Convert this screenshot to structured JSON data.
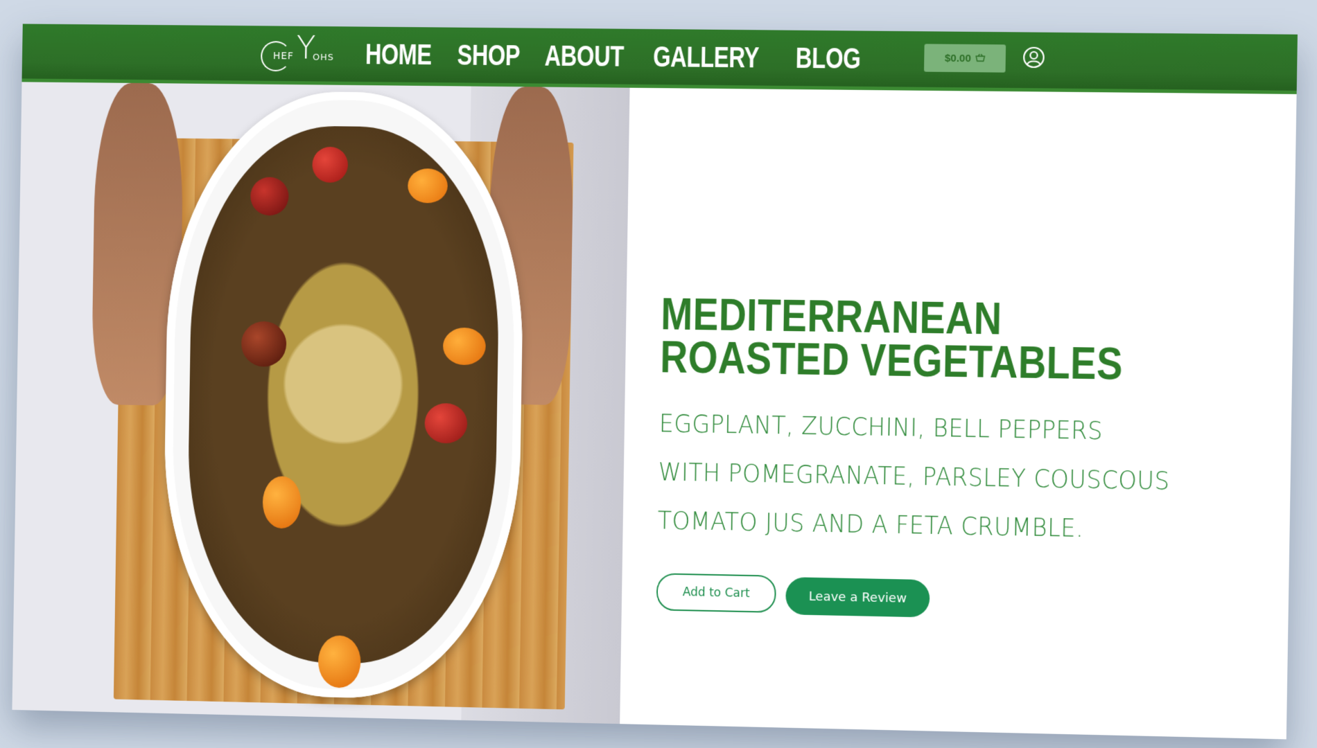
{
  "brand": {
    "logo_text_left": "HEF",
    "logo_letter": "Y",
    "logo_text_right": "OHS",
    "logo_alt": "CHEF YOHS"
  },
  "nav": {
    "items": [
      {
        "label": "HOME"
      },
      {
        "label": "SHOP"
      },
      {
        "label": "ABOUT"
      },
      {
        "label": "GALLERY"
      },
      {
        "label": "BLOG"
      }
    ]
  },
  "cart": {
    "total": "$0.00",
    "icon": "basket-icon"
  },
  "account": {
    "icon": "user-circle-icon"
  },
  "product": {
    "title": "MEDITERRANEAN ROASTED VEGETABLES",
    "description_lines": [
      "EGGPLANT, ZUCCHINI, BELL PEPPERS",
      "WITH POMEGRANATE, PARSLEY COUSCOUS",
      "TOMATO JUS AND A FETA CRUMBLE."
    ],
    "add_to_cart_label": "Add to Cart",
    "review_label": "Leave a Review"
  },
  "colors": {
    "header_green": "#2d6f27",
    "title_green": "#2e7d2a",
    "button_green": "#1b9153",
    "background": "#cfd9e6"
  }
}
